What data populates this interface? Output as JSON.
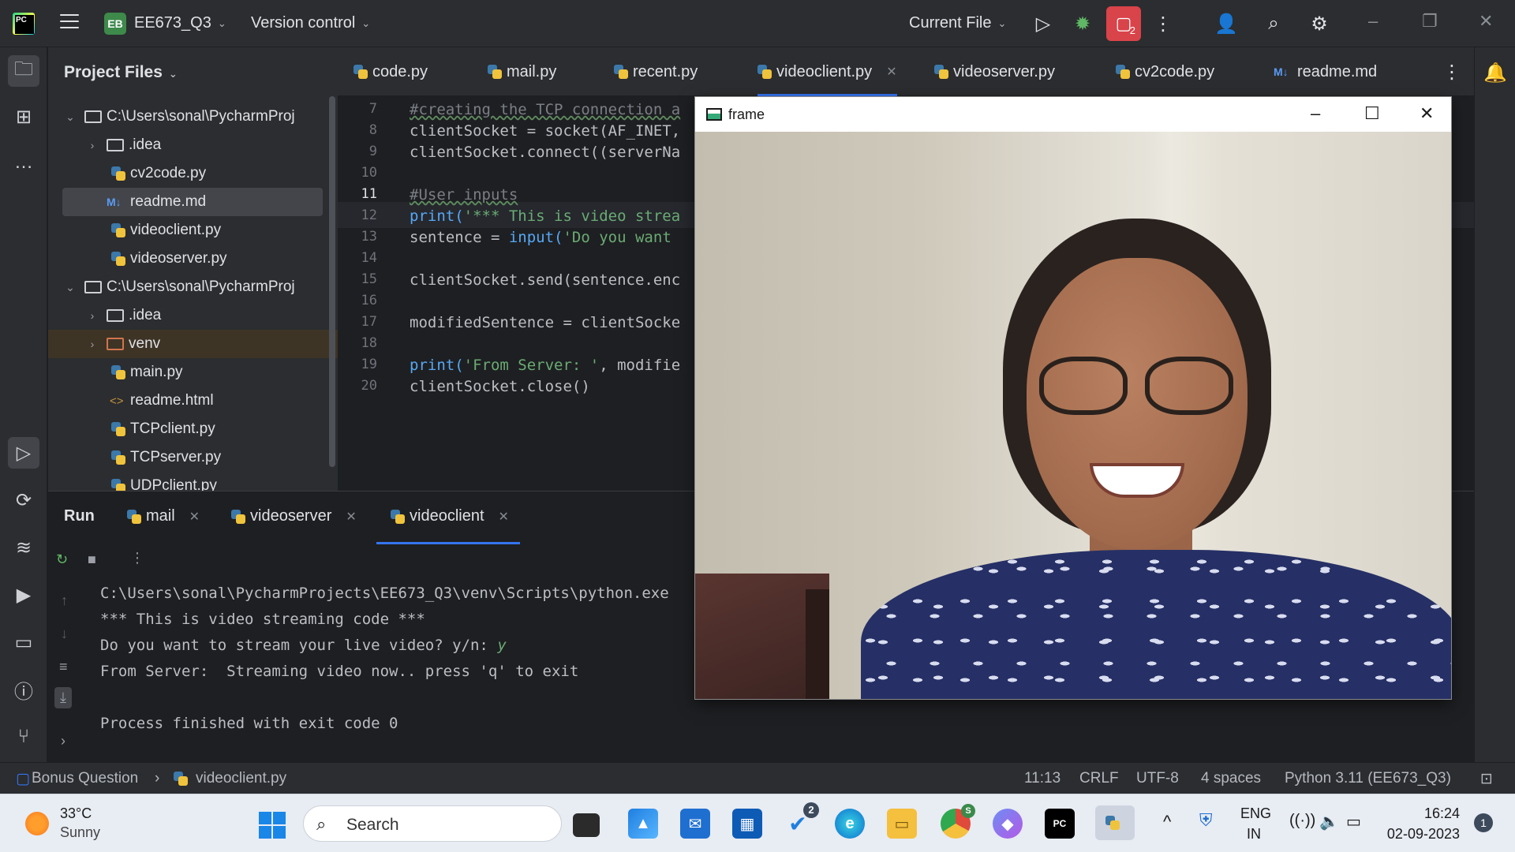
{
  "titlebar": {
    "project_badge": "EB",
    "project_name": "EE673_Q3",
    "version_control": "Version control",
    "run_config": "Current File",
    "notification_badge": "2"
  },
  "project_panel": {
    "title": "Project Files",
    "tree": [
      {
        "label": "C:\\Users\\sonal\\PycharmProj",
        "kind": "folder",
        "chevron": "⌄"
      },
      {
        "label": ".idea",
        "kind": "folder",
        "chevron": "›"
      },
      {
        "label": "cv2code.py",
        "kind": "py"
      },
      {
        "label": "readme.md",
        "kind": "md"
      },
      {
        "label": "videoclient.py",
        "kind": "py"
      },
      {
        "label": "videoserver.py",
        "kind": "py"
      },
      {
        "label": "C:\\Users\\sonal\\PycharmProj",
        "kind": "folder",
        "chevron": "⌄"
      },
      {
        "label": ".idea",
        "kind": "folder",
        "chevron": "›"
      },
      {
        "label": "venv",
        "kind": "folder-orange",
        "chevron": "›"
      },
      {
        "label": "main.py",
        "kind": "py"
      },
      {
        "label": "readme.html",
        "kind": "html"
      },
      {
        "label": "TCPclient.py",
        "kind": "py"
      },
      {
        "label": "TCPserver.py",
        "kind": "py"
      },
      {
        "label": "UDPclient.py",
        "kind": "py"
      }
    ]
  },
  "tabs": [
    {
      "label": "code.py",
      "icon": "python-icon"
    },
    {
      "label": "mail.py",
      "icon": "python-icon"
    },
    {
      "label": "recent.py",
      "icon": "python-icon"
    },
    {
      "label": "videoclient.py",
      "icon": "python-icon"
    },
    {
      "label": "videoserver.py",
      "icon": "python-icon"
    },
    {
      "label": "cv2code.py",
      "icon": "python-icon"
    },
    {
      "label": "readme.md",
      "icon": "markdown-icon",
      "prefix": "M↓"
    }
  ],
  "editor": {
    "line_numbers": [
      "7",
      "8",
      "9",
      "10",
      "11",
      "12",
      "13",
      "14",
      "15",
      "16",
      "17",
      "18",
      "19",
      "20"
    ],
    "lines": [
      {
        "parts": [
          {
            "t": "#creating the TCP connection a",
            "c": "cmt"
          }
        ]
      },
      {
        "parts": [
          {
            "t": "clientSocket = socket(AF_INET,",
            "c": ""
          }
        ]
      },
      {
        "parts": [
          {
            "t": "clientSocket.connect((serverNa",
            "c": ""
          }
        ]
      },
      {
        "parts": []
      },
      {
        "parts": [
          {
            "t": "#User inputs",
            "c": "cmt"
          }
        ]
      },
      {
        "parts": [
          {
            "t": "print(",
            "c": "fn"
          },
          {
            "t": "'*** This is video strea",
            "c": "str"
          }
        ]
      },
      {
        "parts": [
          {
            "t": "sentence = ",
            "c": ""
          },
          {
            "t": "input(",
            "c": "fn"
          },
          {
            "t": "'Do you want ",
            "c": "str"
          }
        ]
      },
      {
        "parts": []
      },
      {
        "parts": [
          {
            "t": "clientSocket.send(sentence.enc",
            "c": ""
          }
        ]
      },
      {
        "parts": []
      },
      {
        "parts": [
          {
            "t": "modifiedSentence = clientSocke",
            "c": ""
          }
        ]
      },
      {
        "parts": []
      },
      {
        "parts": [
          {
            "t": "print(",
            "c": "fn"
          },
          {
            "t": "'From Server: '",
            "c": "str"
          },
          {
            "t": ", modifie",
            "c": ""
          }
        ]
      },
      {
        "parts": [
          {
            "t": "clientSocket.close()",
            "c": ""
          }
        ]
      }
    ]
  },
  "run_panel": {
    "title": "Run",
    "tabs": [
      "mail",
      "videoserver",
      "videoclient"
    ],
    "console": {
      "path": "C:\\Users\\sonal\\PycharmProjects\\EE673_Q3\\venv\\Scripts\\python.exe",
      "line1": "*** This is video streaming code ***",
      "prompt": "Do you want to stream your live video? y/n: ",
      "answer": "y",
      "server": "From Server:  Streaming video now.. press 'q' to exit",
      "finished": "Process finished with exit code 0"
    }
  },
  "frame_window": {
    "title": "frame"
  },
  "statusbar": {
    "breadcrumb_root": "Bonus Question",
    "breadcrumb_file": "videoclient.py",
    "position": "11:13",
    "line_sep": "CRLF",
    "encoding": "UTF-8",
    "indent": "4 spaces",
    "interpreter": "Python 3.11 (EE673_Q3)"
  },
  "taskbar": {
    "temperature": "33°C",
    "condition": "Sunny",
    "search_placeholder": "Search",
    "todo_badge": "2",
    "chrome_badge": "S",
    "lang_top": "ENG",
    "lang_bottom": "IN",
    "time": "16:24",
    "date": "02-09-2023",
    "notification_count": "1"
  },
  "colors": {
    "accent": "#3574f0",
    "stop_button": "#d9434a",
    "string": "#6aab73",
    "function": "#56a8f5"
  }
}
